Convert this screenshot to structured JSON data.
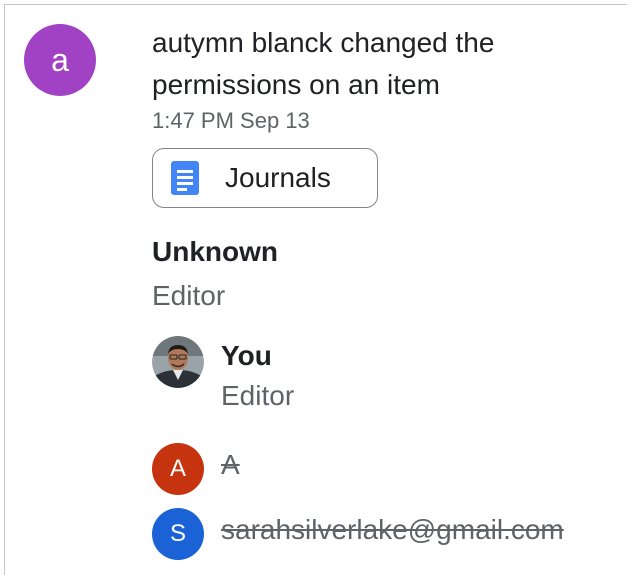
{
  "activity": {
    "actor_initial": "a",
    "actor_avatar_color": "#a142c4",
    "description": "autymn blanck changed the permissions on an item",
    "timestamp": "1:47 PM Sep 13"
  },
  "file_chip": {
    "icon": "google-docs-icon",
    "icon_color": "#4285f4",
    "name": "Journals"
  },
  "permission_group": {
    "title": "Unknown",
    "role": "Editor"
  },
  "people": [
    {
      "name": "You",
      "role": "Editor",
      "avatar": "profile-photo",
      "struck": false
    },
    {
      "initial": "A",
      "name": "A",
      "avatar_color": "#c5330f",
      "struck": true
    },
    {
      "initial": "S",
      "name": "sarahsilverlake@gmail.com",
      "avatar_color": "#1a62d6",
      "struck": true
    }
  ]
}
